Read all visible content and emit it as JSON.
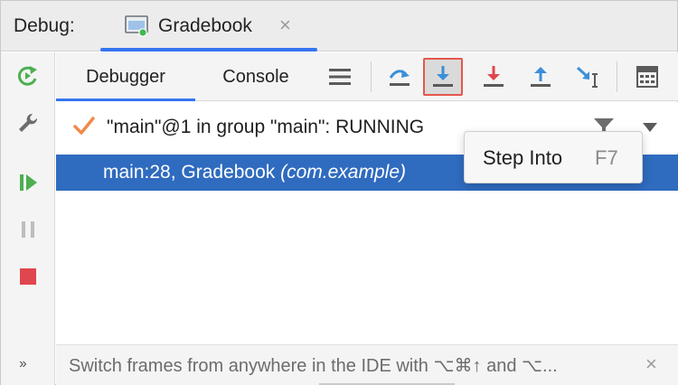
{
  "header": {
    "debug_label": "Debug:",
    "session_tab": {
      "title": "Gradebook",
      "close_glyph": "×"
    }
  },
  "toolbar": {
    "tabs": [
      {
        "label": "Debugger",
        "active": true
      },
      {
        "label": "Console",
        "active": false
      }
    ],
    "icons": [
      "hamburger-menu-icon",
      "step-over-icon",
      "step-into-icon",
      "force-step-into-icon",
      "step-out-icon",
      "run-to-cursor-icon",
      "evaluate-expression-icon"
    ],
    "highlighted_button": "step-into-icon"
  },
  "leftbar": {
    "icons": [
      "rerun-icon",
      "wrench-icon",
      "resume-icon",
      "pause-icon",
      "stop-icon"
    ],
    "more_glyph": "››"
  },
  "thread": {
    "status_text": "\"main\"@1 in group \"main\": RUNNING"
  },
  "frame": {
    "method": "main:28, Gradebook ",
    "package": "(com.example)"
  },
  "tooltip": {
    "label": "Step Into",
    "shortcut": "F7"
  },
  "hint": {
    "text": "Switch frames from anywhere in the IDE with ⌥⌘↑ and ⌥...",
    "close_glyph": "×"
  },
  "colors": {
    "accent": "#3574f0",
    "selection": "#2f6bbf",
    "rerun": "#4caf50",
    "stop": "#e0464e",
    "step_blue": "#3a8fd9",
    "step_red": "#e0464e",
    "highlight_border": "#e5574a",
    "check": "#f08a4b"
  }
}
